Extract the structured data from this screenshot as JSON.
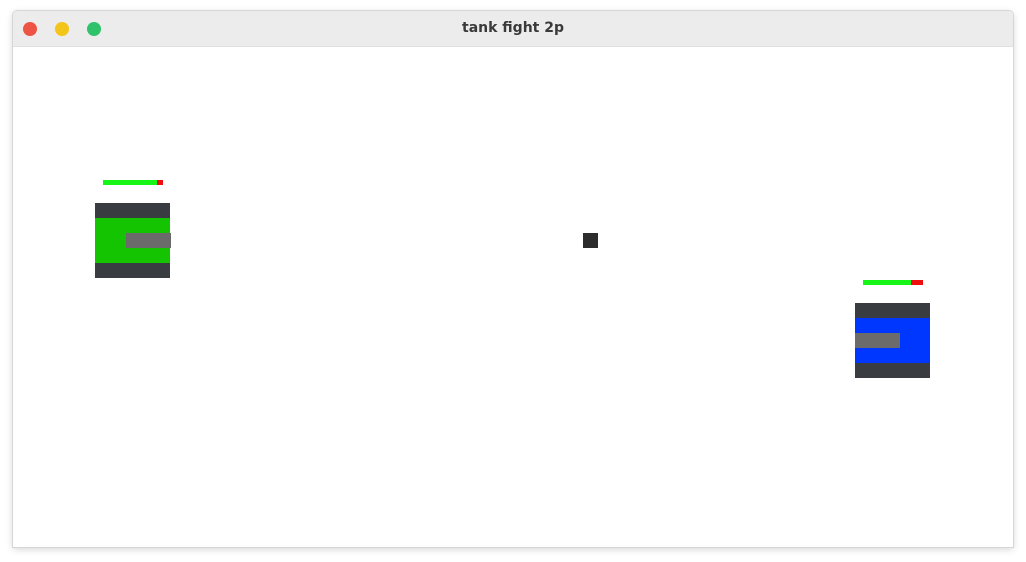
{
  "window": {
    "title": "tank fight 2p",
    "controls": [
      "close",
      "minimize",
      "maximize"
    ]
  },
  "game": {
    "players": [
      {
        "id": "player1",
        "hull_color": "#15c400",
        "facing": "right",
        "health_fraction": 0.9
      },
      {
        "id": "player2",
        "hull_color": "#0037ff",
        "facing": "left",
        "health_fraction": 0.8
      }
    ],
    "projectiles": [
      {
        "id": "shell",
        "color": "#2c2c2c"
      }
    ],
    "colors": {
      "health_good": "#16f516",
      "health_lost": "#ee0e0e",
      "tread": "#393c41",
      "turret": "#6b6b6b"
    }
  }
}
